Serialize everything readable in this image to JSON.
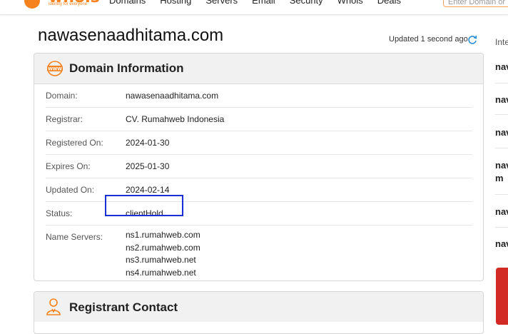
{
  "nav": {
    "logo_text": "whois",
    "logo_tagline": "identity for everyone",
    "items": [
      "Domains",
      "Hosting",
      "Servers",
      "Email",
      "Security",
      "Whois",
      "Deals"
    ],
    "search_placeholder": "Enter Domain or IP"
  },
  "page": {
    "title": "nawasenaadhitama.com",
    "updated": "Updated 1 second ago"
  },
  "domain_info": {
    "heading": "Domain Information",
    "rows": [
      {
        "label": "Domain:",
        "value": "nawasenaadhitama.com"
      },
      {
        "label": "Registrar:",
        "value": "CV. Rumahweb Indonesia"
      },
      {
        "label": "Registered On:",
        "value": "2024-01-30"
      },
      {
        "label": "Expires On:",
        "value": "2025-01-30"
      },
      {
        "label": "Updated On:",
        "value": "2024-02-14"
      },
      {
        "label": "Status:",
        "value": "clientHold"
      }
    ],
    "name_servers_label": "Name Servers:",
    "name_servers": [
      "ns1.rumahweb.com",
      "ns2.rumahweb.com",
      "ns3.rumahweb.net",
      "ns4.rumahweb.net"
    ]
  },
  "registrant": {
    "heading": "Registrant Contact"
  },
  "sidebar": {
    "header": "Inte",
    "items": [
      "nav",
      "nav",
      "nav",
      "nav",
      "m",
      "nav",
      "nav"
    ]
  },
  "colors": {
    "accent": "#f5821f",
    "highlight_box": "#1a2fd6",
    "red_block": "#d22a25"
  }
}
